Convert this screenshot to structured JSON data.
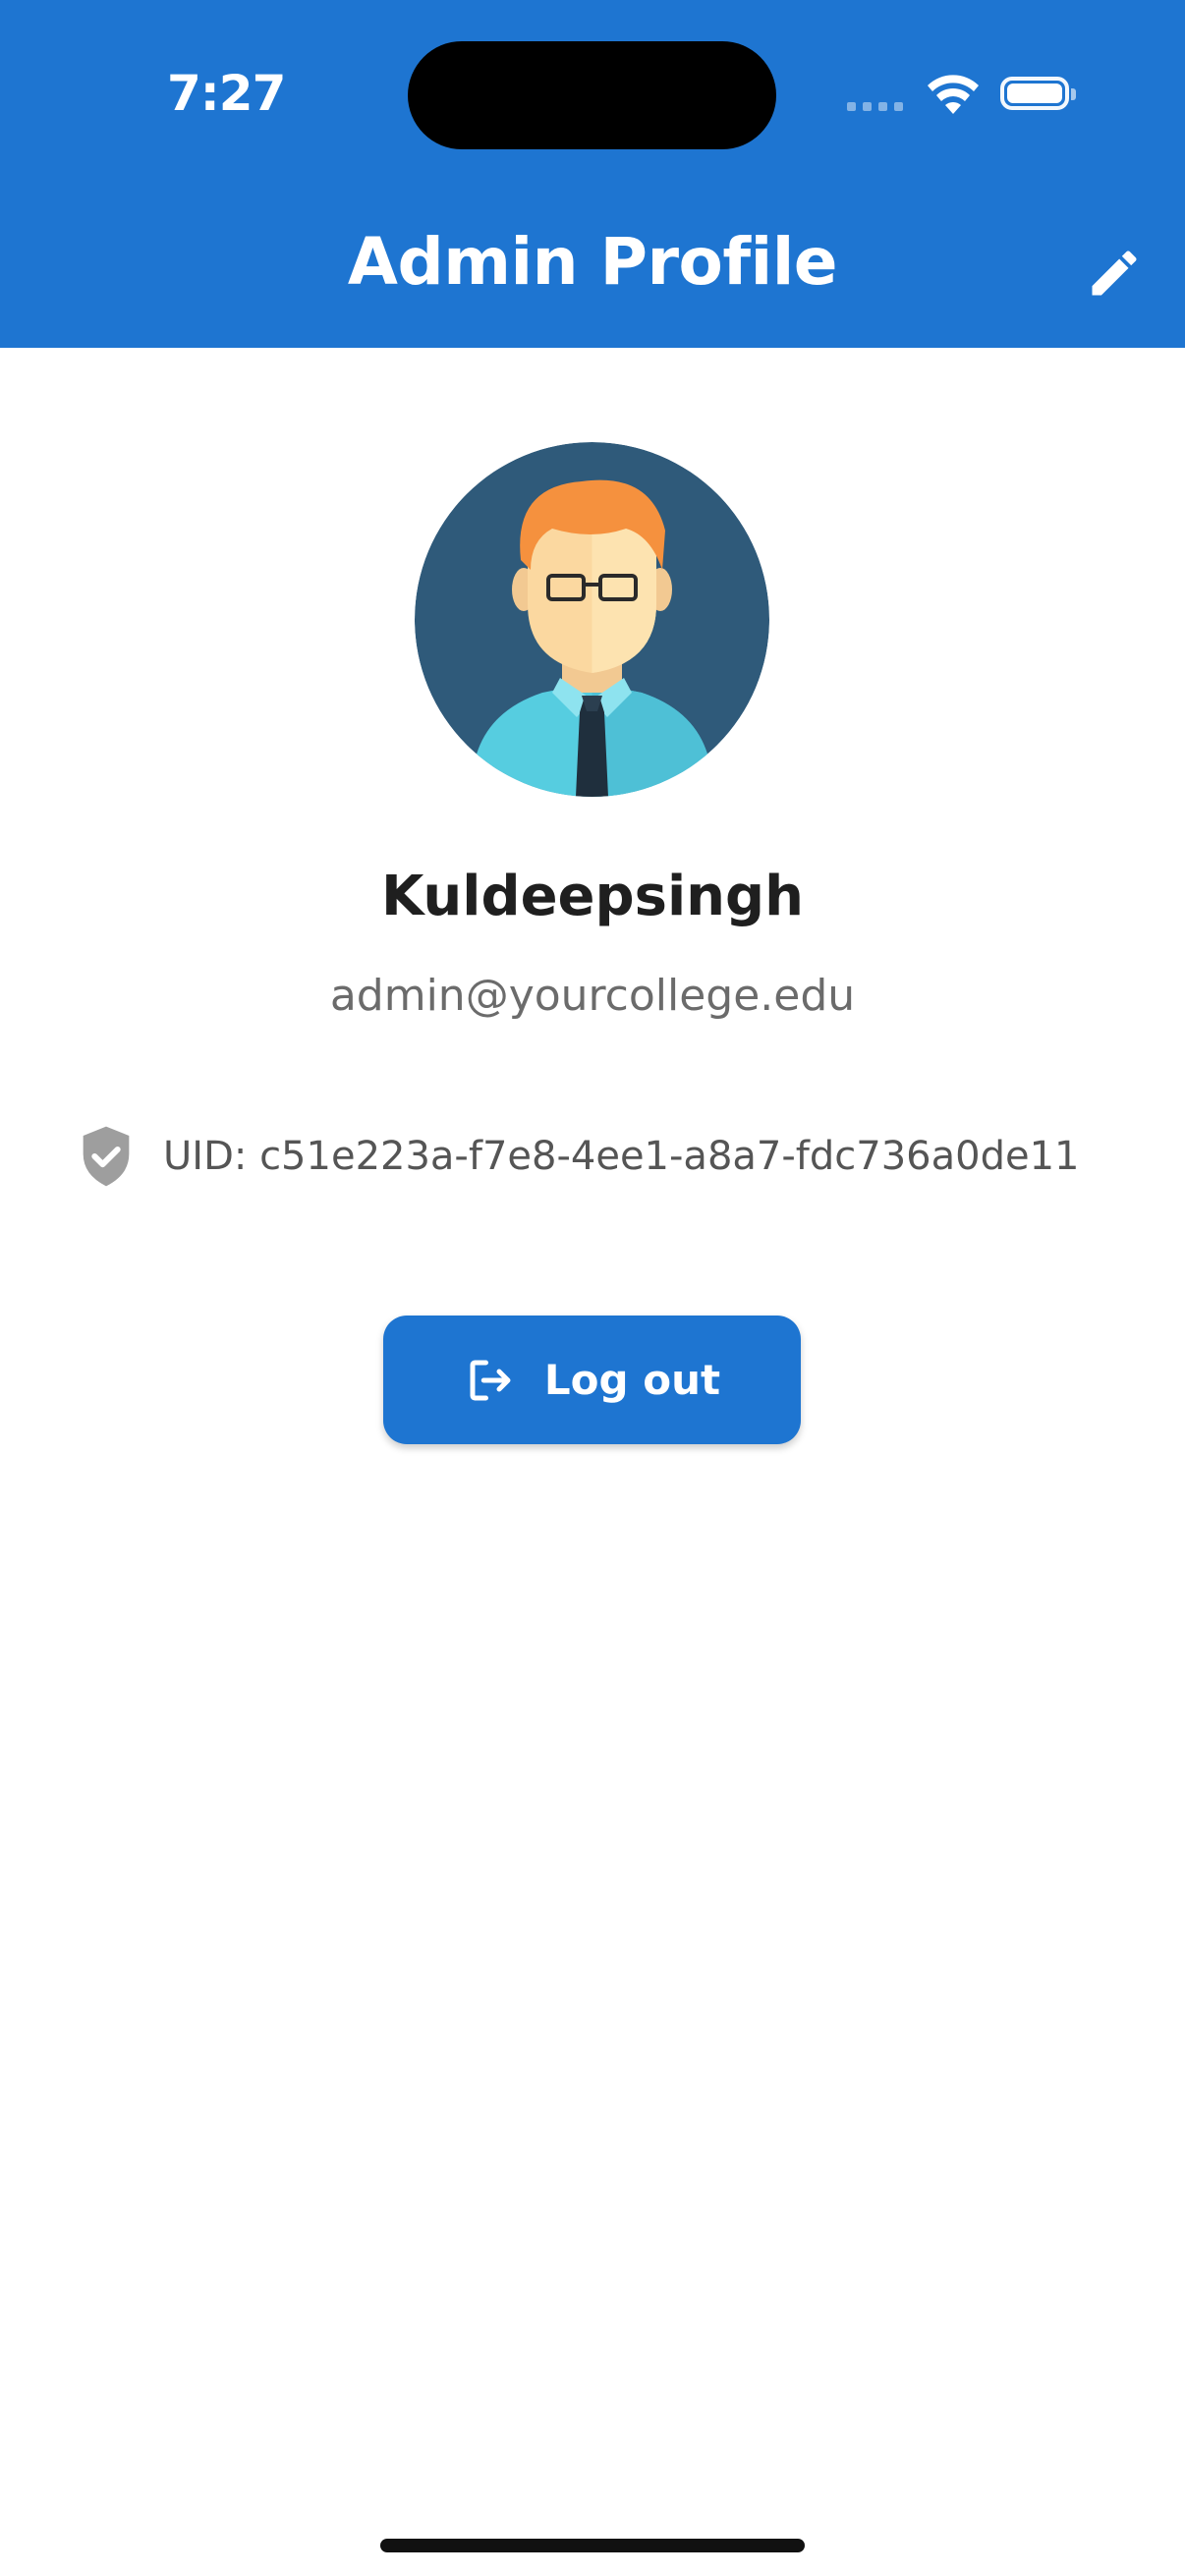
{
  "status_bar": {
    "time": "7:27"
  },
  "header": {
    "title": "Admin Profile",
    "edit_icon": "pencil-icon",
    "background_color": "#1e75d1"
  },
  "profile": {
    "avatar_icon": "person-avatar",
    "name": "Kuldeepsingh",
    "email": "admin@yourcollege.edu",
    "uid_icon": "shield-check-icon",
    "uid": "UID: c51e223a-f7e8-4ee1-a8a7-fdc736a0de11"
  },
  "actions": {
    "logout_label": "Log out",
    "logout_icon": "logout-icon",
    "button_color": "#1e75d1"
  }
}
